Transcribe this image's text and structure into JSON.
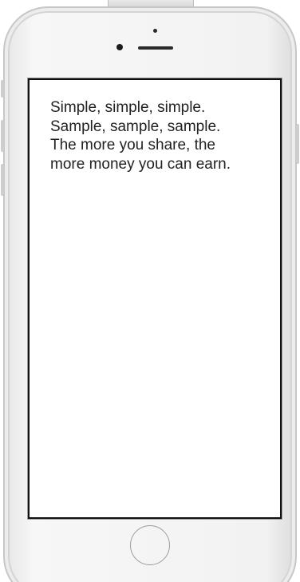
{
  "screen": {
    "lines": [
      "Simple, simple, simple.",
      "Sample, sample, sample.",
      "The more you share, the",
      "more money you can earn."
    ]
  },
  "device": {
    "frame_color": "#f2f2f2",
    "screen_border_color": "#111111",
    "home_button_icon": "home-button-ring"
  }
}
